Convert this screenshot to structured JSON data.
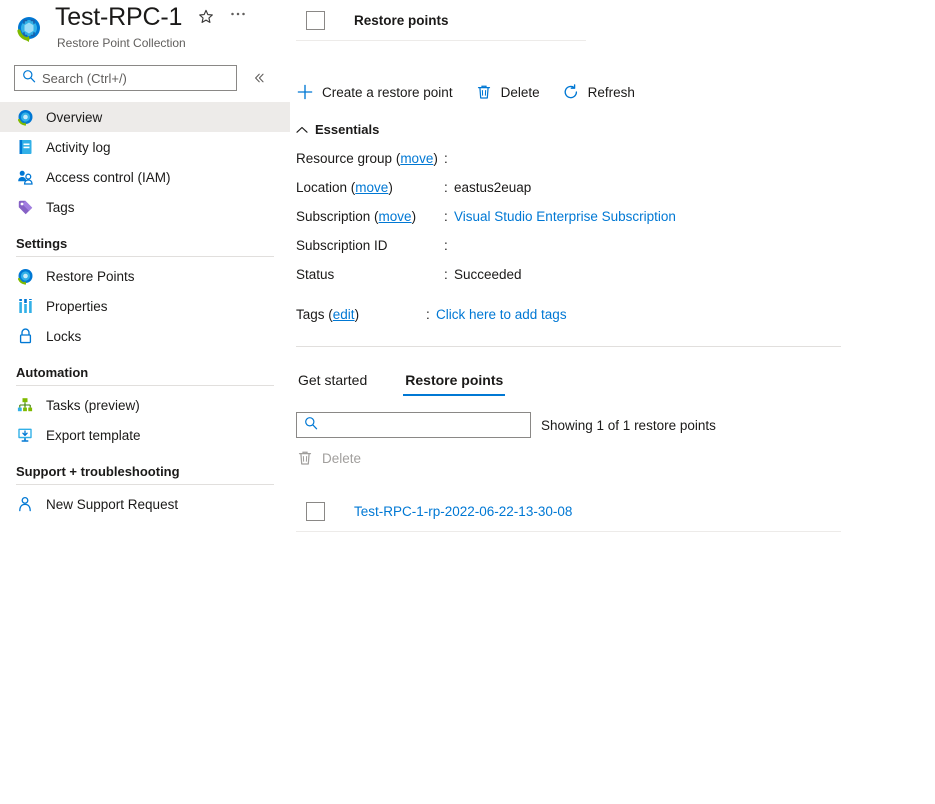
{
  "header": {
    "title": "Test-RPC-1",
    "subtitle": "Restore Point Collection",
    "favorite_icon": "star-icon",
    "more_icon": "ellipsis-icon",
    "resource_icon": "restore-point-collection-icon"
  },
  "sidebar": {
    "search": {
      "placeholder": "Search (Ctrl+/)",
      "value": ""
    },
    "collapse_label": "«",
    "items": [
      {
        "label": "Overview",
        "icon": "overview-icon",
        "selected": true
      },
      {
        "label": "Activity log",
        "icon": "activity-log-icon",
        "selected": false
      },
      {
        "label": "Access control (IAM)",
        "icon": "access-control-icon",
        "selected": false
      },
      {
        "label": "Tags",
        "icon": "tags-icon",
        "selected": false
      }
    ],
    "groups": [
      {
        "title": "Settings",
        "items": [
          {
            "label": "Restore Points",
            "icon": "restore-points-icon"
          },
          {
            "label": "Properties",
            "icon": "properties-icon"
          },
          {
            "label": "Locks",
            "icon": "lock-icon"
          }
        ]
      },
      {
        "title": "Automation",
        "items": [
          {
            "label": "Tasks (preview)",
            "icon": "tasks-icon"
          },
          {
            "label": "Export template",
            "icon": "export-template-icon"
          }
        ]
      },
      {
        "title": "Support + troubleshooting",
        "items": [
          {
            "label": "New Support Request",
            "icon": "support-request-icon"
          }
        ]
      }
    ]
  },
  "commandbar": {
    "create_label": "Create a restore point",
    "create_icon": "plus-icon",
    "delete_label": "Delete",
    "delete_icon": "trash-icon",
    "refresh_label": "Refresh",
    "refresh_icon": "refresh-icon"
  },
  "essentials": {
    "title": "Essentials",
    "chevron_icon": "chevron-up-icon",
    "rows": [
      {
        "label": "Resource group",
        "sublink": "move",
        "value": "",
        "redacted": true,
        "is_link": false
      },
      {
        "label": "Location",
        "sublink": "move",
        "value": "eastus2euap",
        "redacted": false,
        "is_link": false
      },
      {
        "label": "Subscription",
        "sublink": "move",
        "value": "Visual Studio Enterprise Subscription",
        "redacted": false,
        "is_link": true
      },
      {
        "label": "Subscription ID",
        "sublink": "",
        "value": "",
        "redacted": true,
        "is_link": false
      },
      {
        "label": "Status",
        "sublink": "",
        "value": "Succeeded",
        "redacted": false,
        "is_link": false
      }
    ],
    "tags": {
      "label": "Tags",
      "sublink": "edit",
      "value": "Click here to add tags"
    }
  },
  "tabs": [
    {
      "label": "Get started",
      "active": false
    },
    {
      "label": "Restore points",
      "active": true
    }
  ],
  "restore_points_tab": {
    "filter": {
      "placeholder": "",
      "value": "",
      "icon": "search-icon"
    },
    "showing_text": "Showing 1 of 1 restore points",
    "grid_delete": {
      "label": "Delete",
      "icon": "trash-icon",
      "disabled": true
    },
    "table": {
      "column_header": "Restore points",
      "select_all_checkbox": "select-all-checkbox",
      "rows": [
        {
          "name": "Test-RPC-1-rp-2022-06-22-13-30-08",
          "checked": false
        }
      ]
    }
  },
  "colors": {
    "accent": "#0078d4",
    "link": "#0078d4",
    "text": "#1b1a19",
    "muted": "#605e5c",
    "disabled": "#a19f9d",
    "divider": "#e1dfdd",
    "selected_bg": "#edebe9",
    "border": "#8a8886"
  }
}
